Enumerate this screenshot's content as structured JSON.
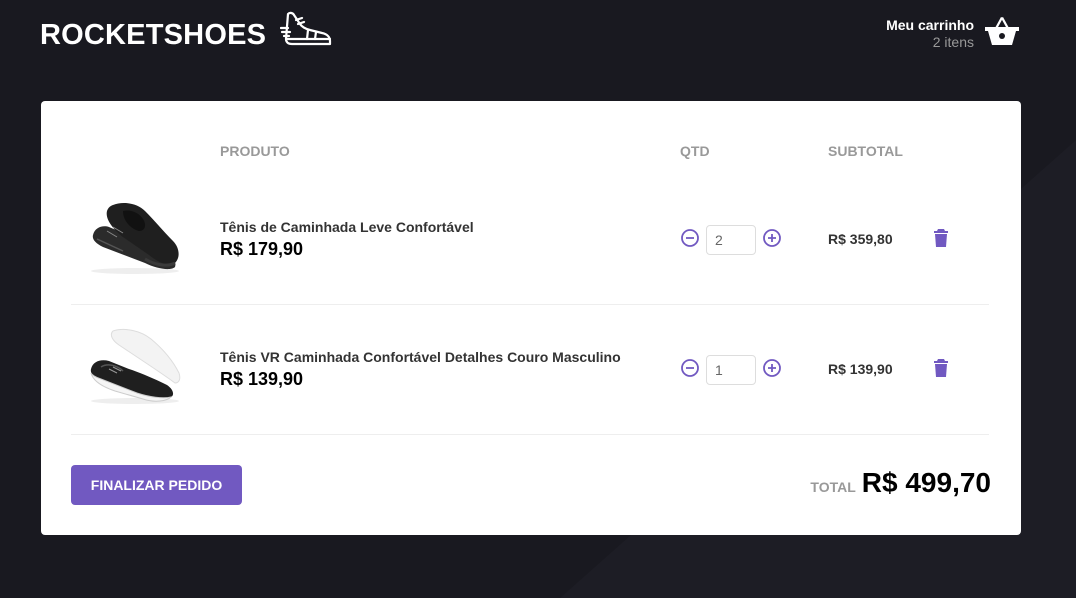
{
  "header": {
    "logo_text": "ROCKETSHOES",
    "cart_title": "Meu carrinho",
    "cart_count": "2 itens"
  },
  "table": {
    "headers": [
      "",
      "PRODUTO",
      "QTD",
      "SUBTOTAL",
      ""
    ],
    "items": [
      {
        "title": "Tênis de Caminhada Leve Confortável",
        "price": "R$ 179,90",
        "quantity": "2",
        "subtotal": "R$ 359,80"
      },
      {
        "title": "Tênis VR Caminhada Confortável Detalhes Couro Masculino",
        "price": "R$ 139,90",
        "quantity": "1",
        "subtotal": "R$ 139,90"
      }
    ]
  },
  "footer": {
    "checkout_label": "Finalizar pedido",
    "total_label": "TOTAL",
    "total_value": "R$ 499,70"
  },
  "colors": {
    "background": "#191920",
    "accent": "#7159c1"
  },
  "icons": {
    "logo": "sneaker-icon",
    "cart": "shopping-basket-icon",
    "decrement": "minus-circle-icon",
    "increment": "plus-circle-icon",
    "remove": "trash-icon"
  }
}
